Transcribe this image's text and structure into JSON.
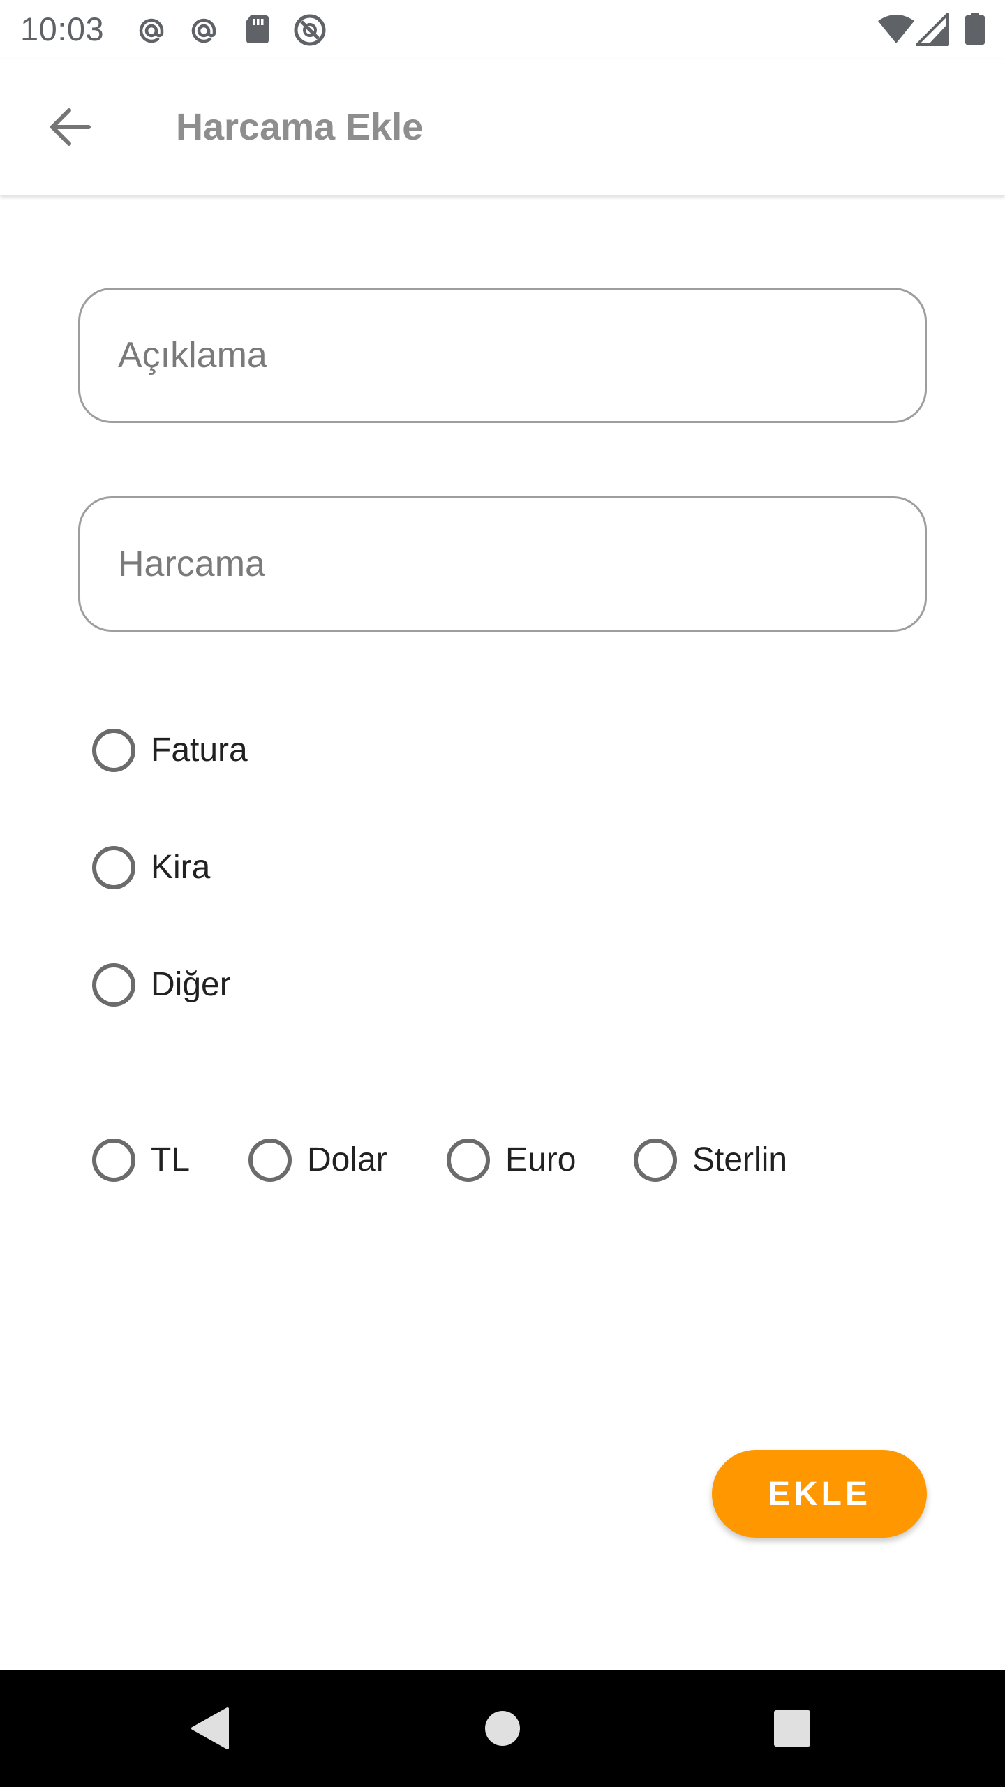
{
  "status_bar": {
    "time": "10:03",
    "left_icons": [
      "at-sign-icon",
      "at-sign-icon",
      "sd-card-icon",
      "do-not-disturb-icon"
    ],
    "right_icons": [
      "wifi-icon",
      "cell-signal-icon",
      "battery-icon"
    ]
  },
  "app_bar": {
    "back_icon": "arrow-back-icon",
    "title": "Harcama Ekle"
  },
  "form": {
    "description_field": {
      "value": "",
      "placeholder": "Açıklama"
    },
    "amount_field": {
      "value": "",
      "placeholder": "Harcama"
    },
    "category_options": [
      {
        "label": "Fatura",
        "selected": false
      },
      {
        "label": "Kira",
        "selected": false
      },
      {
        "label": "Diğer",
        "selected": false
      }
    ],
    "currency_options": [
      {
        "label": "TL",
        "selected": false
      },
      {
        "label": "Dolar",
        "selected": false
      },
      {
        "label": "Euro",
        "selected": false
      },
      {
        "label": "Sterlin",
        "selected": false
      }
    ],
    "submit_label": "EKLE"
  },
  "nav_bar": {
    "buttons": [
      "back-triangle-icon",
      "home-circle-icon",
      "recents-square-icon"
    ]
  },
  "colors": {
    "accent": "#ff9800",
    "title_gray": "#8e8e8e",
    "field_border": "#9e9e9e",
    "radio_border": "#6b6b6b",
    "nav_bar": "#000000"
  }
}
